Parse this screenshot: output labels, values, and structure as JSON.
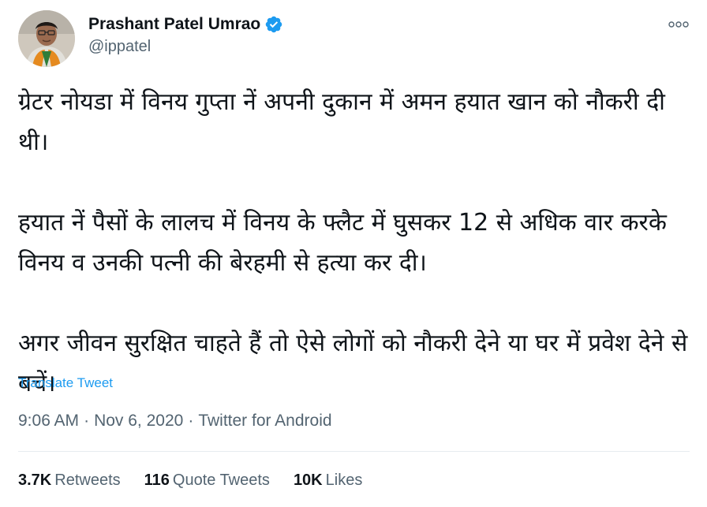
{
  "author": {
    "display_name": "Prashant Patel Umrao",
    "handle": "@ippatel",
    "verified": true,
    "verified_color": "#1d9bf0"
  },
  "tweet": {
    "text": "ग्रेटर नोयडा में विनय गुप्ता नें अपनी दुकान में अमन हयात खान को नौकरी दी थी।\n\nहयात नें पैसों के लालच में विनय के फ्लैट में घुसकर 12 से अधिक वार करके विनय व उनकी पत्नी की बेरहमी से हत्या कर दी।\n\nअगर जीवन सुरक्षित चाहते हैं तो ऐसे लोगों को नौकरी देने या घर में प्रवेश देने से बचें।",
    "translate_label": "Translate Tweet",
    "time": "9:06 AM",
    "date": "Nov 6, 2020",
    "source": "Twitter for Android",
    "separator": "·"
  },
  "stats": {
    "retweets_count": "3.7K",
    "retweets_label": "Retweets",
    "quote_count": "116",
    "quote_label": "Quote Tweets",
    "likes_count": "10K",
    "likes_label": "Likes"
  },
  "colors": {
    "accent": "#1d9bf0",
    "secondary_text": "#536471",
    "primary_text": "#0f1419"
  },
  "icons": {
    "more": "more-horizontal-icon",
    "verified": "verified-badge-icon"
  }
}
